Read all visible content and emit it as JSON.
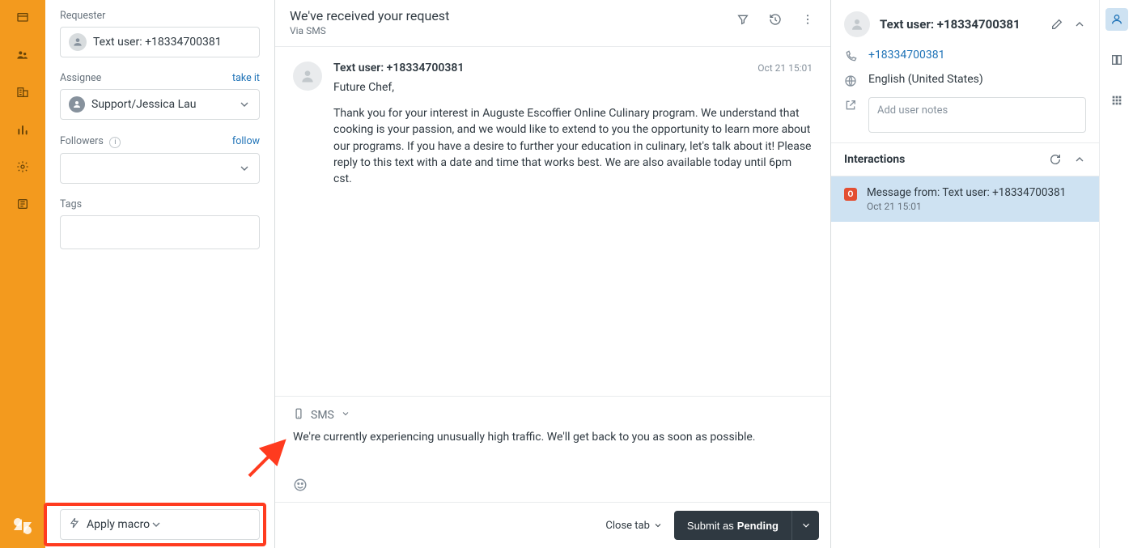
{
  "props": {
    "requester_label": "Requester",
    "requester_value": "Text user: +18334700381",
    "assignee_label": "Assignee",
    "take_it": "take it",
    "assignee_value": "Support/Jessica Lau",
    "followers_label": "Followers",
    "follow": "follow",
    "tags_label": "Tags",
    "macro_label": "Apply macro"
  },
  "header": {
    "title": "We've received your request",
    "subtitle": "Via SMS"
  },
  "message": {
    "author": "Text user: +18334700381",
    "timestamp": "Oct 21 15:01",
    "greeting": "Future Chef,",
    "body": "Thank you for your interest in Auguste Escoffier Online Culinary program. We understand that cooking is your passion, and we would like to extend to you the opportunity to learn more about our programs. If you have a desire to further your education in culinary, let's talk about it! Please reply to this text with a date and time that works best. We are also available today until 6pm cst."
  },
  "composer": {
    "channel": "SMS",
    "draft": "We're currently experiencing unusually high traffic. We'll get back to you as soon as possible."
  },
  "footer": {
    "close_tab": "Close tab",
    "submit_prefix": "Submit as ",
    "submit_status": "Pending"
  },
  "context": {
    "name": "Text user: +18334700381",
    "phone": "+18334700381",
    "language": "English (United States)",
    "notes_placeholder": "Add user notes",
    "interactions_heading": "Interactions",
    "interaction": {
      "status": "O",
      "title": "Message from: Text user: +18334700381",
      "time": "Oct 21 15:01"
    }
  }
}
